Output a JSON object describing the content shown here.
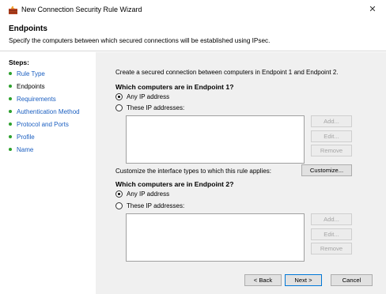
{
  "window": {
    "title": "New Connection Security Rule Wizard",
    "close_glyph": "✕",
    "icon": "firewall-icon"
  },
  "header": {
    "title": "Endpoints",
    "description": "Specify the computers between which secured connections will be established using IPsec."
  },
  "sidebar": {
    "steps_label": "Steps:",
    "items": [
      {
        "label": "Rule Type"
      },
      {
        "label": "Endpoints"
      },
      {
        "label": "Requirements"
      },
      {
        "label": "Authentication Method"
      },
      {
        "label": "Protocol and Ports"
      },
      {
        "label": "Profile"
      },
      {
        "label": "Name"
      }
    ],
    "current_index": 1
  },
  "main": {
    "intro": "Create a secured connection between computers in Endpoint 1 and Endpoint 2.",
    "endpoint1": {
      "heading": "Which computers are in Endpoint 1?",
      "option_any": "Any IP address",
      "option_these": "These IP addresses:",
      "selected": "any"
    },
    "endpoint2": {
      "heading": "Which computers are in Endpoint 2?",
      "option_any": "Any IP address",
      "option_these": "These IP addresses:",
      "selected": "any"
    },
    "list_buttons": {
      "add": "Add...",
      "edit": "Edit...",
      "remove": "Remove"
    },
    "customize_text": "Customize the interface types to which this rule applies:",
    "customize_button": "Customize..."
  },
  "footer": {
    "back": "< Back",
    "next": "Next >",
    "cancel": "Cancel"
  }
}
